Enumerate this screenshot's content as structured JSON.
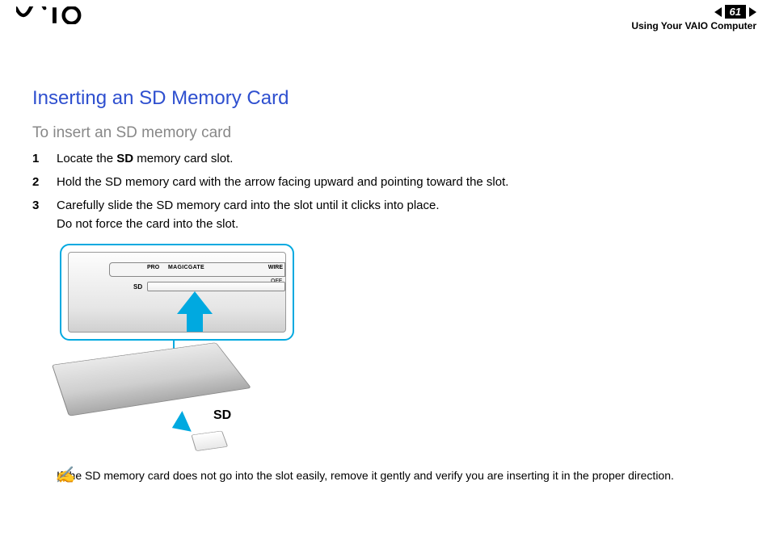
{
  "header": {
    "brand": "VAIO",
    "page_number": "61",
    "section": "Using Your VAIO Computer"
  },
  "page": {
    "title": "Inserting an SD Memory Card",
    "subtitle": "To insert an SD memory card",
    "steps": [
      {
        "n": "1",
        "pre": "Locate the ",
        "bold": "SD",
        "post": " memory card slot."
      },
      {
        "n": "2",
        "pre": "Hold the SD memory card with the arrow facing upward and pointing toward the slot.",
        "bold": "",
        "post": ""
      },
      {
        "n": "3",
        "pre": "Carefully slide the SD memory card into the slot until it clicks into place.",
        "bold": "",
        "post": "",
        "sub": "Do not force the card into the slot."
      }
    ],
    "figure": {
      "callout_labels": {
        "pro": "PRO",
        "magicgate": "MAGICGATE",
        "wire": "WIRE",
        "off": "OFF",
        "sd_small": "SD"
      },
      "sd_label": "SD"
    },
    "note_icon": "✍",
    "note": "If the SD memory card does not go into the slot easily, remove it gently and verify you are inserting it in the proper direction."
  }
}
